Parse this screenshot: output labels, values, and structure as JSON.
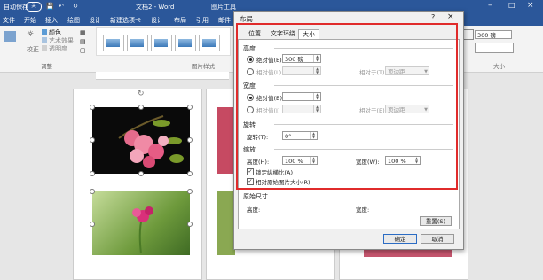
{
  "titlebar": {
    "autosave": "自动保存",
    "autosave_state": "关",
    "doc_name": "文档2 - Word",
    "picture_tools": "图片工具"
  },
  "tabs": [
    "文件",
    "开始",
    "插入",
    "绘图",
    "设计",
    "新建选项卡",
    "设计",
    "布局",
    "引用",
    "邮件"
  ],
  "ribbon": {
    "adjust_label": "调整",
    "color_label": "颜色",
    "art_label": "艺术效果",
    "transparency_label": "透明度",
    "correction_label": "校正",
    "picture_style_label": "图片样式",
    "size_label": "大小",
    "size_value": "300 磅"
  },
  "dialog": {
    "title": "布局",
    "help": "?",
    "close": "×",
    "tabs": [
      "位置",
      "文字环绕",
      "大小"
    ],
    "active_tab": "大小",
    "height": {
      "section": "高度",
      "absolute_label": "绝对值(E)",
      "absolute_value": "300 磅",
      "relative_label": "相对值(L)",
      "relative_to_label": "相对于(T)",
      "relative_to_value": "页边距"
    },
    "width": {
      "section": "宽度",
      "absolute_label": "绝对值(B)",
      "absolute_value": "",
      "relative_label": "相对值(I)",
      "relative_to_label": "相对于(E)",
      "relative_to_value": "页边距"
    },
    "rotate": {
      "section": "旋转",
      "label": "旋转(T):",
      "value": "0°"
    },
    "scale": {
      "section": "缩放",
      "height_label": "高度(H):",
      "height_value": "100 %",
      "width_label": "宽度(W):",
      "width_value": "100 %",
      "lock_aspect": "锁定纵横比(A)",
      "relative_original": "相对原始图片大小(R)"
    },
    "original_size": {
      "section": "原始尺寸",
      "height_label": "高度:",
      "width_label": "宽度:"
    },
    "reset": "重置(S)",
    "ok": "确定",
    "cancel": "取消"
  },
  "colors": {
    "word_blue": "#2b579a",
    "highlight_red": "#e02b2b"
  }
}
